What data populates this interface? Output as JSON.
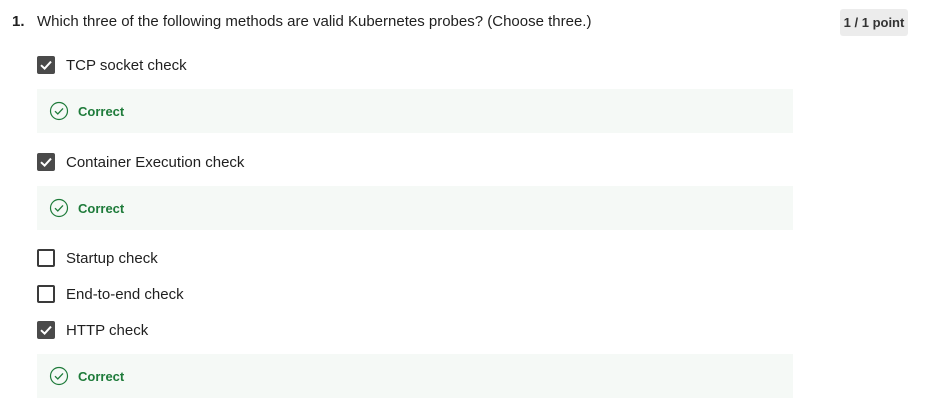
{
  "question": {
    "number": "1.",
    "text": "Which three of the following methods are valid Kubernetes probes? (Choose three.)",
    "points": "1 / 1 point"
  },
  "options": [
    {
      "label": "TCP socket check",
      "checked": true,
      "feedback": "Correct"
    },
    {
      "label": "Container Execution check",
      "checked": true,
      "feedback": "Correct"
    },
    {
      "label": "Startup check",
      "checked": false
    },
    {
      "label": "End-to-end check",
      "checked": false
    },
    {
      "label": "HTTP check",
      "checked": true,
      "feedback": "Correct"
    }
  ],
  "colors": {
    "correct_text": "#1e7b3a",
    "feedback_bg": "#f5f9f6",
    "checkbox_checked": "#4a4a4a",
    "points_badge_bg": "#ececec"
  },
  "icons": {
    "checkbox_checked": "check-icon",
    "feedback_correct": "check-circle-icon"
  }
}
